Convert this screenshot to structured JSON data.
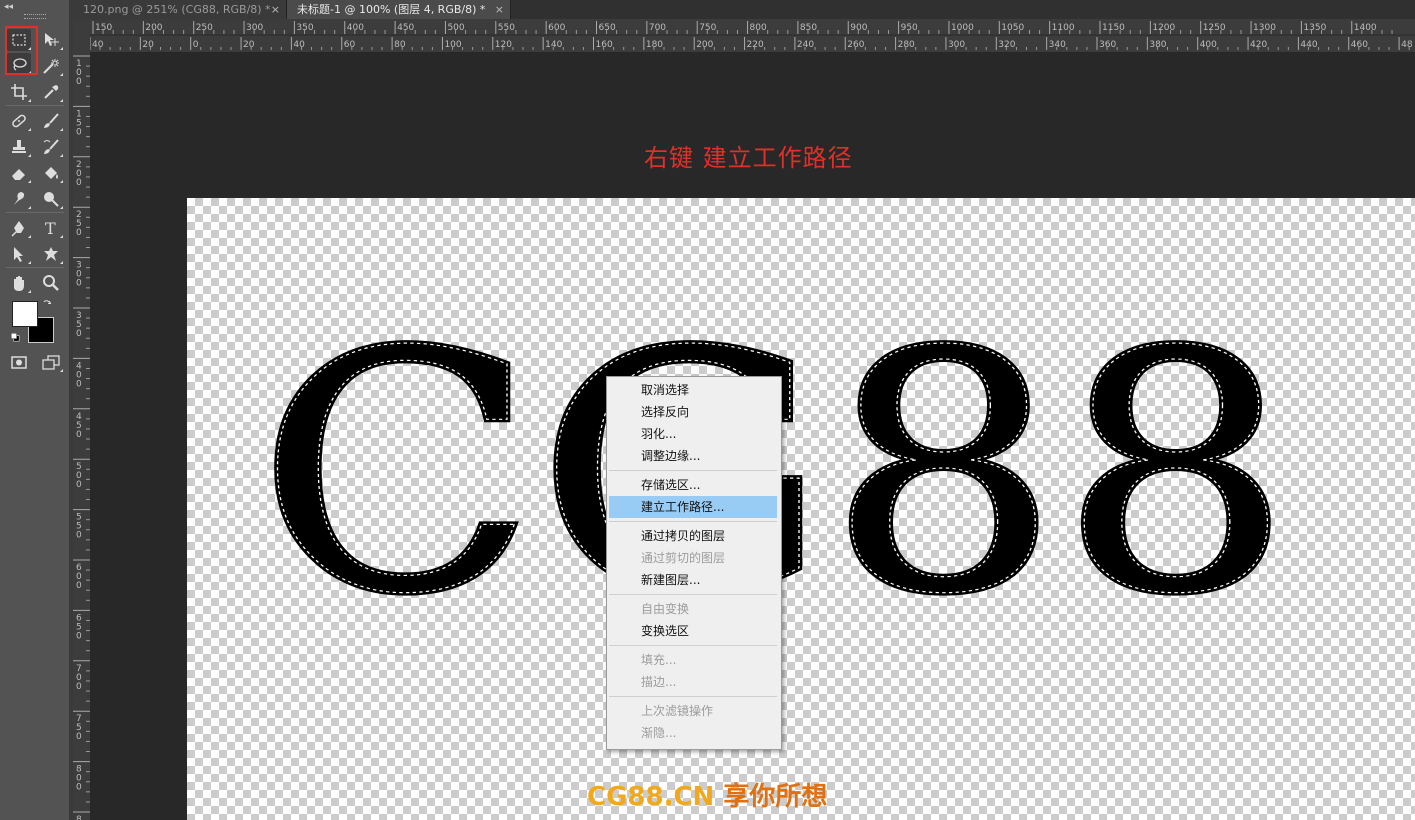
{
  "tabs": [
    {
      "label": "120.png @ 251% (CG88, RGB/8) *",
      "close": "×"
    },
    {
      "label": "未标题-1 @ 100% (图层 4, RGB/8) *",
      "close": "×"
    }
  ],
  "toolbar": {
    "collapse": "◂◂",
    "tools": [
      "rectangular-marquee",
      "move",
      "lasso",
      "magic-wand",
      "crop",
      "eyedropper",
      "healing-brush",
      "brush",
      "clone-stamp",
      "history-brush",
      "eraser",
      "paint-bucket",
      "smudge",
      "dodge",
      "pen",
      "type",
      "path-selection",
      "custom-shape",
      "hand",
      "zoom"
    ],
    "foreground_color": "#ffffff",
    "background_color": "#000000"
  },
  "rulers": {
    "top_major": [
      "150",
      "200",
      "250",
      "300",
      "350",
      "400",
      "450",
      "500",
      "550",
      "600",
      "650",
      "700",
      "750",
      "800",
      "850",
      "900",
      "950",
      "1000",
      "1050",
      "1100",
      "1150",
      "1200",
      "1250",
      "1300",
      "1350",
      "1400"
    ],
    "top_minor": [
      "40",
      "20",
      "0",
      "20",
      "40",
      "60",
      "80",
      "100",
      "120",
      "140",
      "160",
      "180",
      "200",
      "220",
      "240",
      "260",
      "280",
      "300",
      "320",
      "340",
      "360",
      "380",
      "400",
      "420",
      "440",
      "460",
      "48"
    ],
    "left": [
      "1 0 0",
      "1 5 0",
      "2 0 0",
      "2 5 0",
      "3 0 0",
      "3 5 0",
      "4 0 0",
      "4 5 0",
      "5 0 0",
      "5 5 0",
      "6 0 0",
      "6 5 0",
      "7 0 0",
      "7 5 0",
      "8 0 0",
      "8"
    ]
  },
  "canvas": {
    "annotation": "右键  建立工作路径",
    "text_art": "CG88",
    "watermark_brand": "CG88.CN",
    "watermark_slogan": "享你所想"
  },
  "context_menu": {
    "items": [
      {
        "label": "取消选择",
        "enabled": true
      },
      {
        "label": "选择反向",
        "enabled": true
      },
      {
        "label": "羽化...",
        "enabled": true
      },
      {
        "label": "调整边缘...",
        "enabled": true
      },
      {
        "label": "存储选区...",
        "enabled": true
      },
      {
        "label": "建立工作路径...",
        "enabled": true,
        "highlighted": true
      },
      {
        "label": "通过拷贝的图层",
        "enabled": true
      },
      {
        "label": "通过剪切的图层",
        "enabled": false
      },
      {
        "label": "新建图层...",
        "enabled": true
      },
      {
        "label": "自由变换",
        "enabled": false
      },
      {
        "label": "变换选区",
        "enabled": true
      },
      {
        "label": "填充...",
        "enabled": false
      },
      {
        "label": "描边...",
        "enabled": false
      },
      {
        "label": "上次滤镜操作",
        "enabled": false
      },
      {
        "label": "渐隐...",
        "enabled": false
      }
    ]
  },
  "colors": {
    "highlight": "#99ccf5",
    "annotation": "#e0302a",
    "selection_outline": "#e0302a"
  }
}
